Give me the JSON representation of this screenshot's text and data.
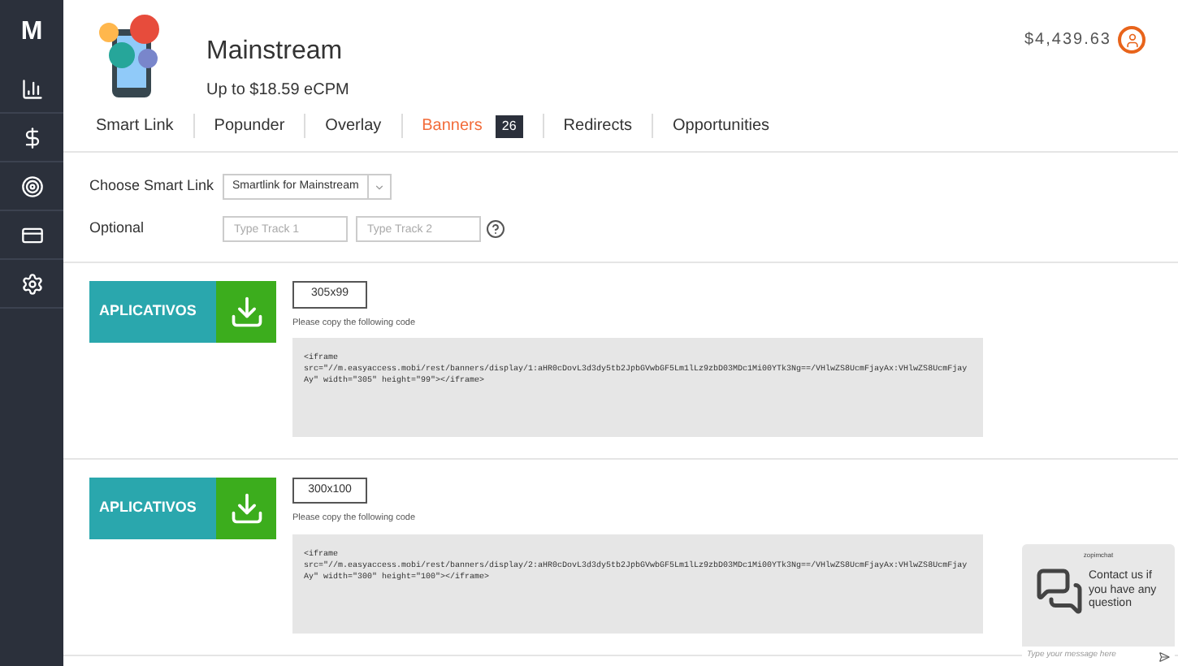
{
  "sidebar": {
    "logo": "M"
  },
  "header": {
    "title": "Mainstream",
    "subtitle": "Up to $18.59 eCPM",
    "balance": "$4,439.63"
  },
  "tabs": [
    {
      "label": "Smart Link",
      "selected": false
    },
    {
      "label": "Popunder",
      "selected": false
    },
    {
      "label": "Overlay",
      "selected": false
    },
    {
      "label": "Banners",
      "selected": true,
      "badge": "26"
    },
    {
      "label": "Redirects",
      "selected": false
    },
    {
      "label": "Opportunities",
      "selected": false
    }
  ],
  "form": {
    "smart_link_label": "Choose Smart Link",
    "smart_link_value": "Smartlink for Mainstream",
    "optional_label": "Optional",
    "track1_placeholder": "Type Track 1",
    "track2_placeholder": "Type Track 2"
  },
  "banners": [
    {
      "image_text": "APLICATIVOS",
      "size": "305x99",
      "instruction": "Please copy the following code",
      "code": "<iframe\nsrc=\"//m.easyaccess.mobi/rest/banners/display/1:aHR0cDovL3d3dy5tb2JpbGVwbGF5Lm1lLz9zbD03MDc1Mi00YTk3Ng==/VHlwZS8UcmFjayAx:VHlwZS8UcmFjayAy\" width=\"305\" height=\"99\"></iframe>"
    },
    {
      "image_text": "APLICATIVOS",
      "size": "300x100",
      "instruction": "Please copy the following code",
      "code": "<iframe\nsrc=\"//m.easyaccess.mobi/rest/banners/display/2:aHR0cDovL3d3dy5tb2JpbGVwbGF5Lm1lLz9zbD03MDc1Mi00YTk3Ng==/VHlwZS8UcmFjayAx:VHlwZS8UcmFjayAy\" width=\"300\" height=\"100\"></iframe>"
    }
  ],
  "chat": {
    "brand": "zopimchat",
    "message": "Contact us if you have any question",
    "placeholder": "Type your message here"
  }
}
